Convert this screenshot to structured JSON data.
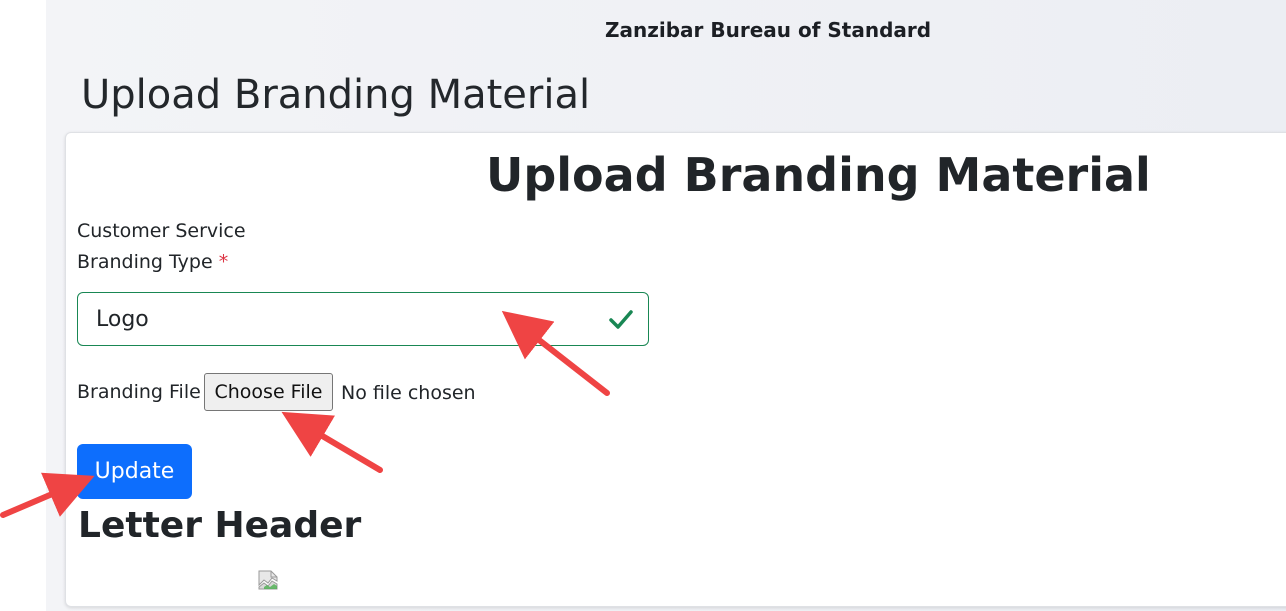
{
  "header": {
    "org_name": "Zanzibar Bureau of Standard"
  },
  "page": {
    "heading": "Upload Branding Material"
  },
  "form": {
    "title": "Upload Branding Material",
    "section_label": "Customer Service",
    "branding_type_label": "Branding Type",
    "required_mark": "*",
    "branding_type_value": "Logo",
    "branding_file_label": "Branding File",
    "choose_file_label": "Choose File",
    "no_file_text": "No file chosen",
    "update_label": "Update"
  },
  "letter_header": {
    "heading": "Letter Header"
  },
  "colors": {
    "primary": "#0d6efd",
    "valid_border": "#198754",
    "annotation_arrow": "#ef4444"
  },
  "icons": [
    "check-icon",
    "broken-image-icon",
    "annotation-arrow"
  ]
}
